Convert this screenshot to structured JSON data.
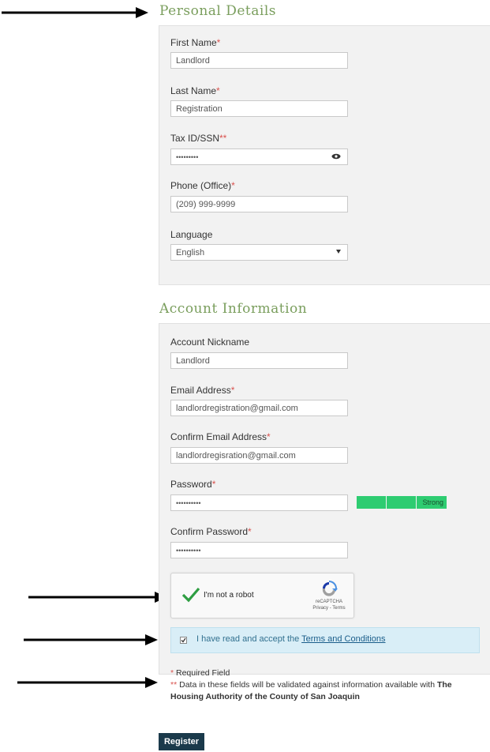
{
  "personal": {
    "title": "Personal Details",
    "first_name": {
      "label": "First Name",
      "required_mark": "*",
      "value": "Landlord"
    },
    "last_name": {
      "label": "Last Name",
      "required_mark": "*",
      "value": "Registration"
    },
    "tax_id": {
      "label": "Tax ID/SSN",
      "required_mark": "**",
      "value": "•••••••••"
    },
    "phone": {
      "label": "Phone (Office)",
      "required_mark": "*",
      "value": "(209) 999-9999"
    },
    "language": {
      "label": "Language",
      "value": "English"
    }
  },
  "account": {
    "title": "Account Information",
    "nickname": {
      "label": "Account Nickname",
      "value": "Landlord"
    },
    "email": {
      "label": "Email Address",
      "required_mark": "*",
      "value": "landlordregistration@gmail.com"
    },
    "confirm_email": {
      "label": "Confirm Email Address",
      "required_mark": "*",
      "value": "landlordregisration@gmail.com"
    },
    "password": {
      "label": "Password",
      "required_mark": "*",
      "value": "••••••••••",
      "strength": "Strong"
    },
    "confirm_password": {
      "label": "Confirm Password",
      "required_mark": "*",
      "value": "••••••••••"
    }
  },
  "captcha": {
    "label": "I'm not a robot",
    "brand": "reCAPTCHA",
    "links": "Privacy - Terms"
  },
  "terms": {
    "prefix": "I have read and accept the ",
    "link": "Terms and Conditions",
    "checked": true
  },
  "notes": {
    "required_mark": "*",
    "required": " Required Field",
    "validated_mark": "**",
    "validated_text": " Data in these fields will be validated against information available with ",
    "validated_org": "The Housing Authority of the County of San Joaquin"
  },
  "register_label": "Register",
  "colors": {
    "section_title": "#7a9e5d",
    "required": "#d9534f",
    "strength": "#2ecc71",
    "terms_bg": "#d9eef7",
    "button": "#1b3a4b",
    "check": "#2e9e42"
  }
}
